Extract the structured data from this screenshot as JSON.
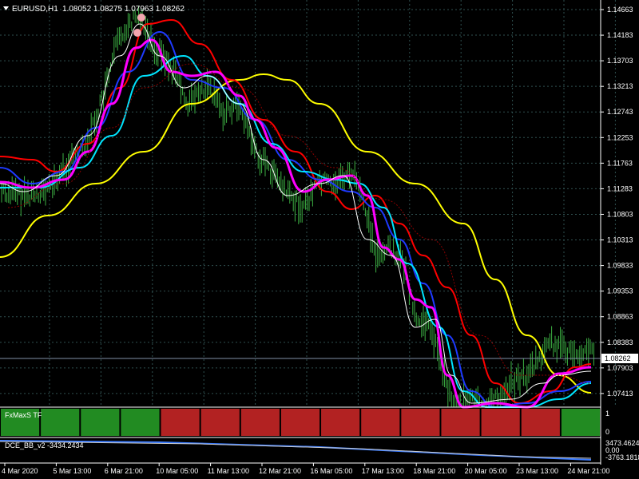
{
  "header": {
    "symbol_timeframe": "EURUSD,H1",
    "ohlc": "1.08052 1.08275 1.07963 1.08262"
  },
  "current_price": "1.08262",
  "price_labels": [
    "1.14663",
    "1.14183",
    "1.13703",
    "1.13213",
    "1.12743",
    "1.12253",
    "1.11763",
    "1.11283",
    "1.10803",
    "1.10313",
    "1.09833",
    "1.09353",
    "1.08863",
    "1.08383",
    "1.07903",
    "1.07413"
  ],
  "time_labels": [
    "4 Mar 2020",
    "5 Mar 13:00",
    "6 Mar 21:00",
    "10 Mar 05:00",
    "11 Mar 13:00",
    "12 Mar 21:00",
    "16 Mar 05:00",
    "17 Mar 13:00",
    "18 Mar 21:00",
    "20 Mar 05:00",
    "23 Mar 13:00",
    "24 Mar 21:00"
  ],
  "indicator1": {
    "name": "FxMaxS TF",
    "scale_top": "1",
    "scale_bottom": "0",
    "segments": [
      "green",
      "green",
      "green",
      "green",
      "red",
      "red",
      "red",
      "red",
      "red",
      "red",
      "red",
      "red",
      "red",
      "red",
      "green"
    ],
    "colors": {
      "green": "#228B22",
      "red": "#B22222"
    }
  },
  "indicator2": {
    "name": "DCE_BB_v2 -3434.2434",
    "scale_top": "3473.4624",
    "scale_mid": "0.00",
    "scale_bottom": "-3763.1818"
  },
  "colors": {
    "background": "#000000",
    "grid": "#2F4F4F",
    "candles": "#3CB043",
    "yellow_ma": "#FFFF00",
    "red_ma": "#FF0000",
    "blue_ma": "#1E3AFF",
    "cyan_ma": "#00E5FF",
    "magenta_ma": "#FF00FF",
    "white_ma": "#FFFFFF"
  },
  "chart_data": {
    "type": "line",
    "x": [
      "4 Mar 2020",
      "5 Mar 13:00",
      "6 Mar 21:00",
      "10 Mar 05:00",
      "11 Mar 13:00",
      "12 Mar 21:00",
      "16 Mar 05:00",
      "17 Mar 13:00",
      "18 Mar 21:00",
      "20 Mar 05:00",
      "23 Mar 13:00",
      "24 Mar 21:00"
    ],
    "ylim": [
      1.0722,
      1.1482
    ],
    "series": [
      {
        "values": [
          1.117,
          1.114,
          1.138,
          1.137,
          1.13,
          1.123,
          1.114,
          1.11,
          1.079,
          1.069,
          1.073,
          1.081
        ]
      },
      {
        "values": [
          1.114,
          1.113,
          1.139,
          1.137,
          1.131,
          1.124,
          1.115,
          1.114,
          1.098,
          1.083,
          1.074,
          1.08
        ]
      },
      {
        "values": [
          1.102,
          1.11,
          1.122,
          1.131,
          1.134,
          1.13,
          1.122,
          1.108,
          1.096,
          1.083,
          1.079
        ]
      }
    ]
  }
}
